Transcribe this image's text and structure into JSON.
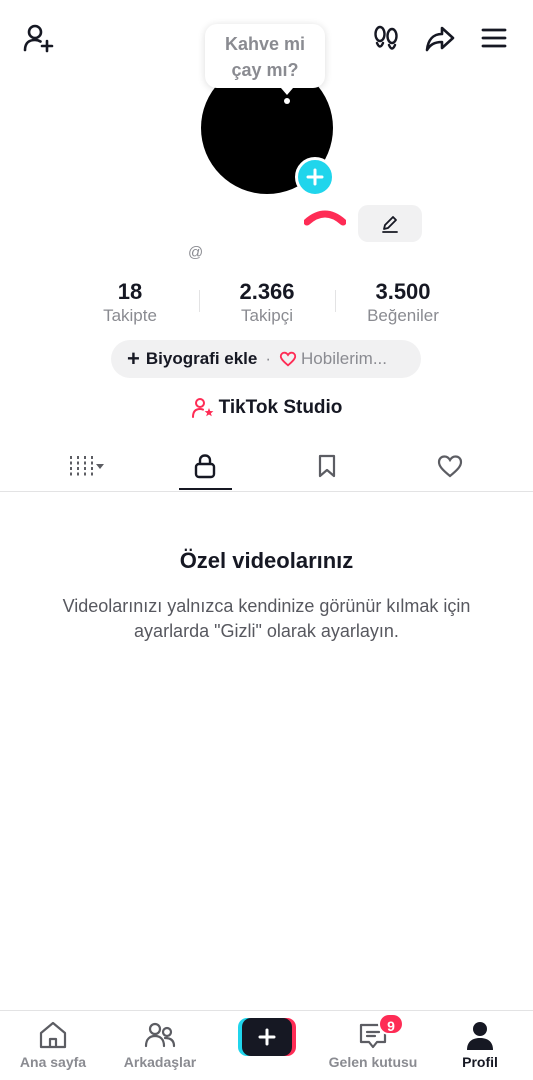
{
  "tooltip": {
    "line1": "Kahve mi",
    "line2": "çay mı?"
  },
  "profile": {
    "username": "@"
  },
  "stats": [
    {
      "value": "18",
      "label": "Takipte"
    },
    {
      "value": "2.366",
      "label": "Takipçi"
    },
    {
      "value": "3.500",
      "label": "Beğeniler"
    }
  ],
  "bio": {
    "add_label": "Biyografi ekle",
    "separator": "·",
    "hobbies_label": "Hobilerim..."
  },
  "studio": {
    "label": "TikTok Studio"
  },
  "tabs": [
    {
      "icon": "grid-icon",
      "active": false
    },
    {
      "icon": "lock-icon",
      "active": true
    },
    {
      "icon": "bookmark-icon",
      "active": false
    },
    {
      "icon": "heart-icon",
      "active": false
    }
  ],
  "empty_state": {
    "title": "Özel videolarınız",
    "description": "Videolarınızı yalnızca kendinize görünür kılmak için ayarlarda \"Gizli\" olarak ayarlayın."
  },
  "bottom_nav": [
    {
      "label": "Ana sayfa",
      "icon": "home-icon",
      "active": false
    },
    {
      "label": "Arkadaşlar",
      "icon": "friends-icon",
      "active": false
    },
    {
      "label": "",
      "icon": "plus-icon",
      "active": false
    },
    {
      "label": "Gelen kutusu",
      "icon": "inbox-icon",
      "active": false,
      "badge": "9"
    },
    {
      "label": "Profil",
      "icon": "profile-icon",
      "active": true
    }
  ],
  "colors": {
    "accent_pink": "#fe2c55",
    "accent_cyan": "#20d5ec",
    "text_primary": "#161823",
    "text_secondary": "#8a8b91"
  }
}
